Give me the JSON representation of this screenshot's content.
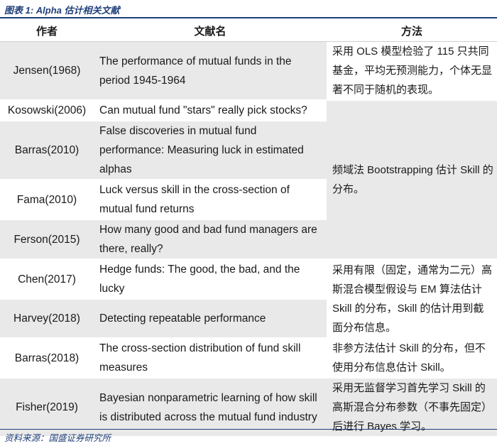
{
  "caption": "图表 1: Alpha 估计相关文献",
  "headers": {
    "author": "作者",
    "title": "文献名",
    "method": "方法"
  },
  "rows": [
    {
      "author": "Jensen(1968)",
      "title": "The performance of mutual funds in the period 1945-1964"
    },
    {
      "author": "Kosowski(2006)",
      "title": "Can mutual fund \"stars\" really pick stocks?"
    },
    {
      "author": "Barras(2010)",
      "title": "False discoveries in mutual fund performance: Measuring luck in estimated alphas"
    },
    {
      "author": "Fama(2010)",
      "title": "Luck versus skill in the cross-section of mutual fund returns"
    },
    {
      "author": "Ferson(2015)",
      "title": "How many good and bad fund managers are there, really?"
    },
    {
      "author": "Chen(2017)",
      "title": "Hedge funds: The good, the bad, and the lucky"
    },
    {
      "author": "Harvey(2018)",
      "title": "Detecting repeatable performance"
    },
    {
      "author": "Barras(2018)",
      "title": "The cross-section distribution of fund skill measures"
    },
    {
      "author": "Fisher(2019)",
      "title": "Bayesian nonparametric learning of how skill is distributed across the mutual fund industry"
    }
  ],
  "methods": {
    "m1": "采用 OLS 模型检验了 115 只共同基金，平均无预测能力，个体无显著不同于随机的表现。",
    "m2": "频域法 Bootstrapping 估计 Skill 的分布。",
    "m3": "采用有限（固定，通常为二元）高斯混合模型假设与 EM 算法估计 Skill 的分布，Skill 的估计用到截面分布信息。",
    "m4": "非参方法估计 Skill 的分布，但不使用分布信息估计 Skill。",
    "m5": "采用无监督学习首先学习 Skill 的高斯混合分布参数（不事先固定）后进行 Bayes 学习。"
  },
  "source": "资料来源：国盛证券研究所"
}
